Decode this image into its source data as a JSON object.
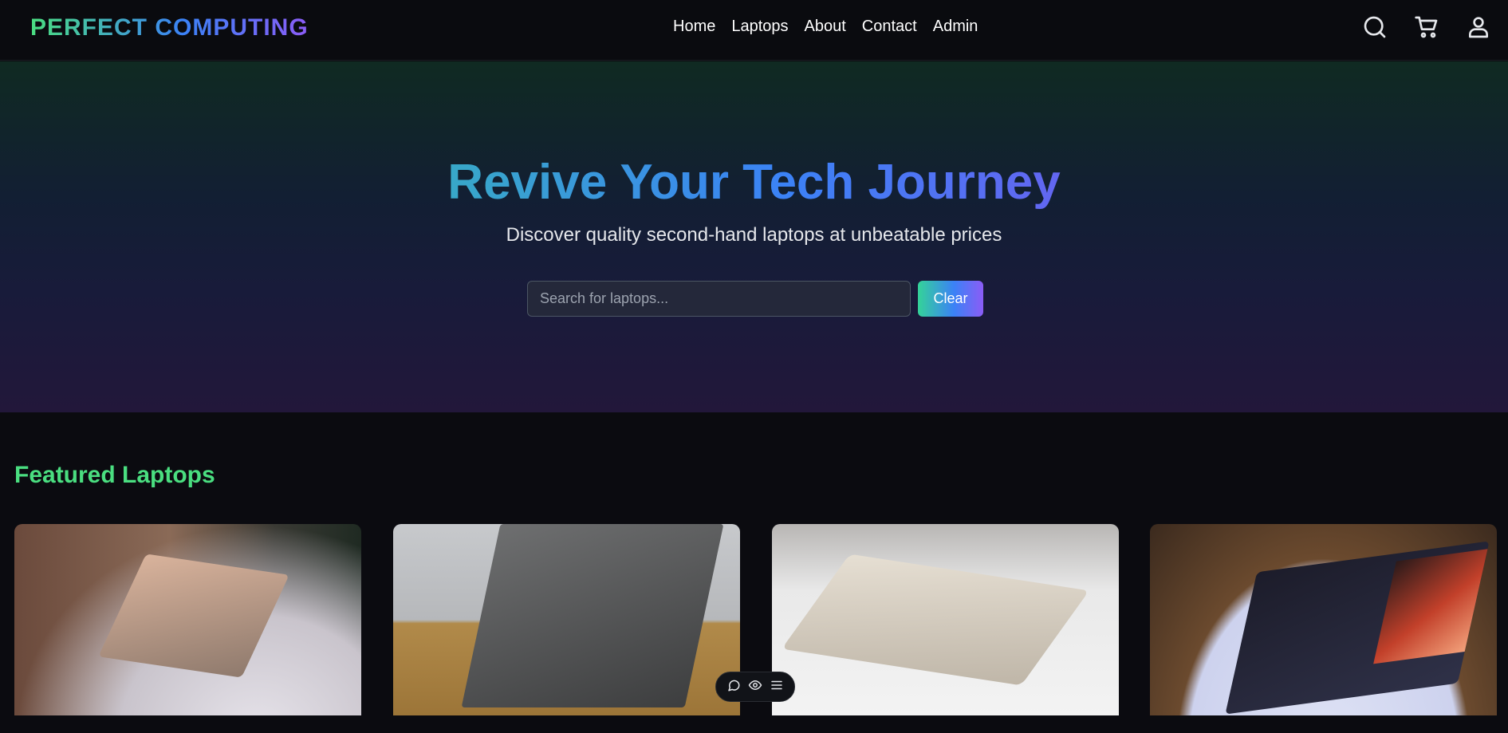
{
  "header": {
    "brand": "PERFECT COMPUTING",
    "nav": [
      "Home",
      "Laptops",
      "About",
      "Contact",
      "Admin"
    ],
    "icons": [
      "search-icon",
      "cart-icon",
      "user-icon"
    ]
  },
  "hero": {
    "title": "Revive Your Tech Journey",
    "subtitle": "Discover quality second-hand laptops at unbeatable prices",
    "search_placeholder": "Search for laptops...",
    "search_value": "",
    "clear_label": "Clear"
  },
  "featured": {
    "title": "Featured Laptops",
    "cards": [
      {
        "image": "laptop-photo-1"
      },
      {
        "image": "laptop-photo-2"
      },
      {
        "image": "laptop-photo-3"
      },
      {
        "image": "laptop-photo-4"
      }
    ]
  },
  "floating_toolbar": {
    "icons": [
      "comment-icon",
      "eye-icon",
      "menu-icon"
    ]
  },
  "colors": {
    "accent_green": "#4ade80",
    "accent_blue": "#3b82f6",
    "accent_purple": "#8b5cf6",
    "background": "#0b0b10"
  }
}
